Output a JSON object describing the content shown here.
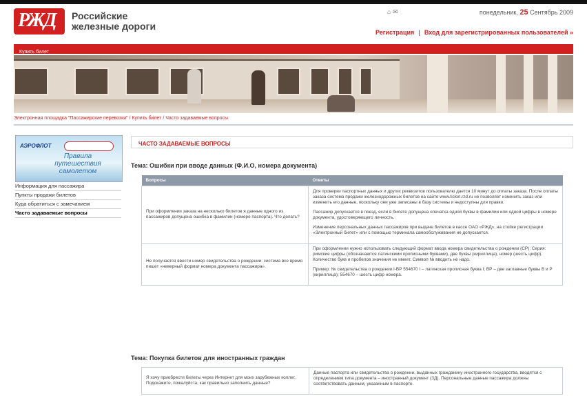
{
  "header": {
    "logo_text": "РЖД",
    "brand_line1": "Российские",
    "brand_line2": "железные дороги",
    "util_links": "⌂ ✉",
    "date_prefix": "понедельник,",
    "date_day": "25",
    "date_rest": "Сентябрь 2009",
    "register_link": "Регистрация",
    "login_link": "Вход для зарегистрированных пользователей »"
  },
  "section_bar": {
    "label": "Купить билет"
  },
  "breadcrumb": "Электронная площадка \"Пассажирские перевозки\" / Купить билет / Часто задаваемые вопросы",
  "ad": {
    "brand": "АЭРОФЛОТ",
    "slogan": "Правила путешествия самолетом"
  },
  "sidebar": {
    "items": [
      {
        "label": "Информация для пассажира"
      },
      {
        "label": "Пункты продажи билетов"
      },
      {
        "label": "Куда обратиться с замечанием"
      },
      {
        "label": "Часто задаваемые вопросы"
      }
    ]
  },
  "page_title": "ЧАСТО ЗАДАВАЕМЫЕ ВОПРОСЫ",
  "topics": [
    {
      "title": "Тема: Ошибки при вводе данных (Ф.И.О, номера документа)",
      "col_q": "Вопросы",
      "col_a": "Ответы",
      "rows": [
        {
          "question": "При оформлении заказа на несколько билетов я данные одного из пассажиров допущена ошибка в фамилии (номере паспорта). Что делать?",
          "answers": [
            "Для проверки паспортных данных и других реквизитов пользователю дается 10 минут до оплаты заказа. После оплаты заказа система продажи железнодорожных билетов на сайте www.ticket.rzd.ru не позволяет изменить заказ или изменить его данные, поскольку они уже записаны в базу системы и недоступны для правки.",
            "Пассажир допускается в поезд, если в билете допущена опечатка одной буквы в фамилии или одной цифры в номере документа, удостоверяющего личность.",
            "Изменение персональных данных пассажиров при выдаче билетов в кассе ОАО «РЖД», на стойке регистрации «Электронный билет» или с помощью терминала самообслуживания не допускается."
          ]
        },
        {
          "question": "Не получается ввести номер свидетельства о рождении: система все время пишет «неверный формат номера документа пассажира».",
          "answers": [
            "При оформлении нужно использовать следующий формат ввода номера свидетельства о рождении (СР): Серия: римские цифры (обозначаются латинскими прописными буквами), две буквы (кириллица), номер (шесть цифр). Количество букв и пробелов значения не имеет. Символ № вводить не надо.",
            "Пример: № свидетельства о рождении I-ВР 554670 I – латинская прописная буква I; ВР – две заглавные буквы В и Р (кириллица); 554670 – шесть цифр номера."
          ]
        }
      ]
    },
    {
      "title": "Тема: Покупка билетов для иностранных граждан",
      "col_q": "",
      "col_a": "",
      "rows": [
        {
          "question": "Я хочу приобрести билеты через Интернет для моих зарубежных коллег. Подскажите, пожалуйста, как правильно заполнить данные?",
          "answers": [
            "Данные паспорта или свидетельства о рождении, выданных гражданину иностранного государства, вводятся с определением типа документа – иностранный документ (ЗД). Персональные данные пассажира должны соответствовать данным, указанным в паспорте."
          ]
        }
      ]
    }
  ]
}
